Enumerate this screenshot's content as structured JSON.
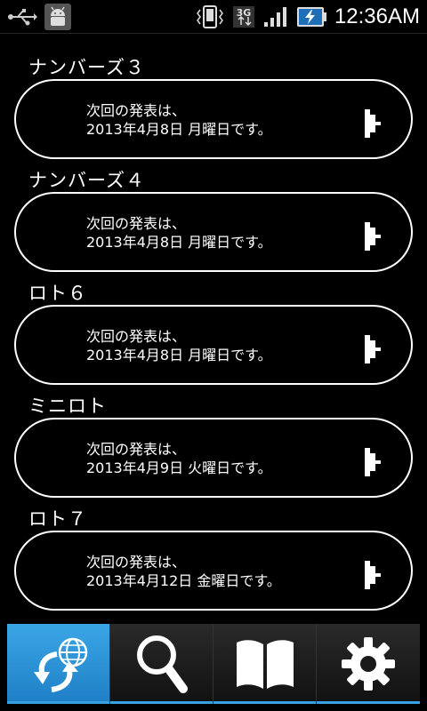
{
  "status_bar": {
    "time": "12:36AM",
    "network": "3G"
  },
  "sections": [
    {
      "title": "ナンバーズ３",
      "line1": "次回の発表は、",
      "line2": "2013年4月8日 月曜日です。"
    },
    {
      "title": "ナンバーズ４",
      "line1": "次回の発表は、",
      "line2": "2013年4月8日 月曜日です。"
    },
    {
      "title": "ロト６",
      "line1": "次回の発表は、",
      "line2": "2013年4月8日 月曜日です。"
    },
    {
      "title": "ミニロト",
      "line1": "次回の発表は、",
      "line2": "2013年4月9日 火曜日です。"
    },
    {
      "title": "ロト７",
      "line1": "次回の発表は、",
      "line2": "2013年4月12日 金曜日です。"
    }
  ],
  "tabs": [
    {
      "icon": "globe-sync-icon",
      "active": true
    },
    {
      "icon": "search-icon",
      "active": false
    },
    {
      "icon": "book-icon",
      "active": false
    },
    {
      "icon": "gear-icon",
      "active": false
    }
  ],
  "colors": {
    "accent": "#2a90d6",
    "background": "#000000",
    "text": "#ffffff"
  }
}
